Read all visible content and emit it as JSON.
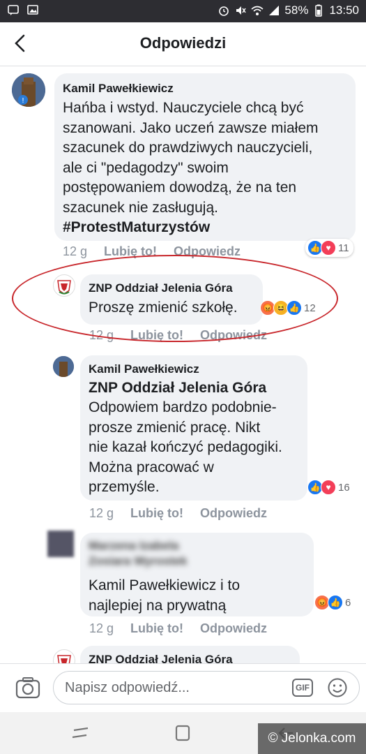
{
  "status_bar": {
    "battery": "58%",
    "time": "13:50"
  },
  "header": {
    "title": "Odpowiedzi"
  },
  "comments": [
    {
      "author": "Kamil Pawełkiewicz",
      "text": "Hańba i wstyd. Nauczyciele chcą być\nszanowani. Jako uczeń zawsze miałem\nszacunek do prawdziwych nauczycieli,\nale ci \"pedagodzy\" swoim\npostępowaniem dowodzą, że na ten\nszacunek nie zasługują.",
      "hashtag": "#ProtestMaturzystów",
      "time": "12 g",
      "like": "Lubię to!",
      "reply": "Odpowiedz",
      "reaction_count": "11"
    },
    {
      "author": "ZNP Oddział Jelenia Góra",
      "text": "Proszę zmienić szkołę.",
      "time": "12 g",
      "like": "Lubię to!",
      "reply": "Odpowiedz",
      "reaction_count": "12"
    },
    {
      "author": "Kamil Pawełkiewicz",
      "mention": "ZNP Oddział Jelenia Góra",
      "text": "Odpowiem bardzo podobnie-\nprosze zmienić pracę.  Nikt\nnie kazał kończyć pedagogiki.\nMożna pracować w\nprzemyśle.",
      "time": "12 g",
      "like": "Lubię to!",
      "reply": "Odpowiedz",
      "reaction_count": "16"
    },
    {
      "author_blurred": "Marzena Izabela Zosiara Wyrostek",
      "text": "Kamil Pawełkiewicz i to\nnajlepiej na prywatną",
      "time": "12 g",
      "like": "Lubię to!",
      "reply": "Odpowiedz",
      "reaction_count": "6"
    },
    {
      "author": "ZNP Oddział Jelenia Góra"
    }
  ],
  "input": {
    "placeholder": "Napisz odpowiedź...",
    "gif_label": "GIF"
  },
  "watermark": "© Jelonka.com",
  "colors": {
    "accent": "#1877f2",
    "ellipse": "#c8262b",
    "bubble": "#f0f2f5"
  }
}
